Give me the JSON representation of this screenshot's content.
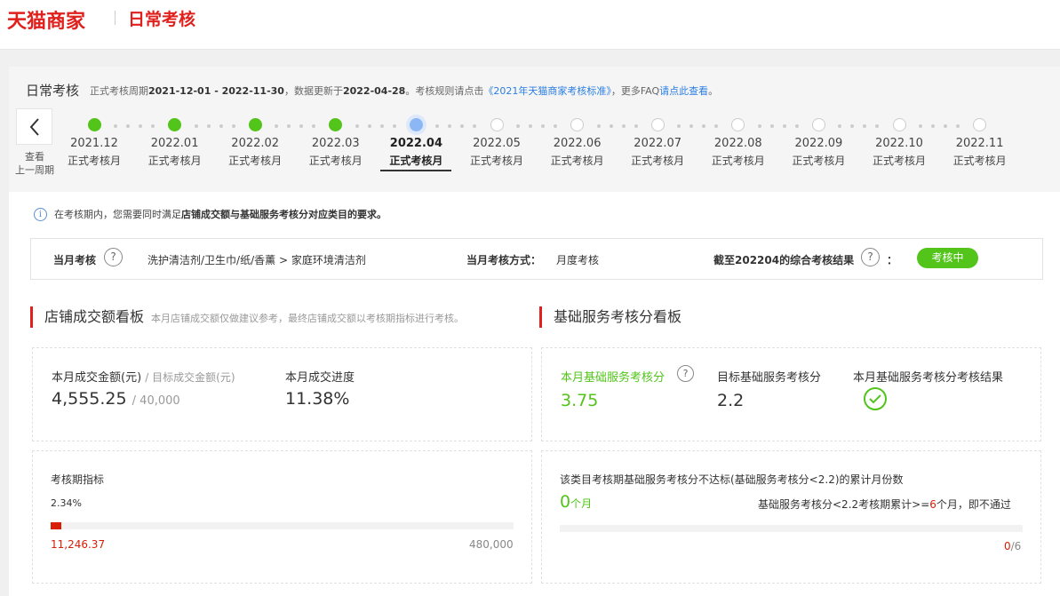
{
  "header": {
    "brand": "天猫商家",
    "section": "日常考核"
  },
  "cycle": {
    "title": "日常考核",
    "desc_prefix": "正式考核周期",
    "period": "2021-12-01 - 2022-11-30",
    "desc_mid": "，数据更新于",
    "updated": "2022-04-28",
    "desc_rule": "。考核规则请点击",
    "rule_link": "《2021年天猫商家考核标准》",
    "desc_faq": "，更多FAQ",
    "faq_link": "请点此查看",
    "desc_end": "。",
    "prev_label_1": "查看",
    "prev_label_2": "上一周期"
  },
  "timeline": [
    {
      "date": "2021.12",
      "label": "正式考核月",
      "state": "done"
    },
    {
      "date": "2022.01",
      "label": "正式考核月",
      "state": "done"
    },
    {
      "date": "2022.02",
      "label": "正式考核月",
      "state": "done"
    },
    {
      "date": "2022.03",
      "label": "正式考核月",
      "state": "done"
    },
    {
      "date": "2022.04",
      "label": "正式考核月",
      "state": "current"
    },
    {
      "date": "2022.05",
      "label": "正式考核月",
      "state": "future"
    },
    {
      "date": "2022.06",
      "label": "正式考核月",
      "state": "future"
    },
    {
      "date": "2022.07",
      "label": "正式考核月",
      "state": "future"
    },
    {
      "date": "2022.08",
      "label": "正式考核月",
      "state": "future"
    },
    {
      "date": "2022.09",
      "label": "正式考核月",
      "state": "future"
    },
    {
      "date": "2022.10",
      "label": "正式考核月",
      "state": "future"
    },
    {
      "date": "2022.11",
      "label": "正式考核月",
      "state": "future"
    }
  ],
  "notice": {
    "prefix": "在考核期内，您需要同时满足",
    "bold": "店铺成交额与基础服务考核分对应类目的要求。"
  },
  "summary": {
    "month_label": "当月考核",
    "category": "洗护清洁剂/卫生巾/纸/香薰 > 家庭环境清洁剂",
    "method_label": "当月考核方式：",
    "method_value": "月度考核",
    "result_label": "截至202204的综合考核结果",
    "colon": "：",
    "result_badge": "考核中"
  },
  "sales": {
    "title": "店铺成交额看板",
    "subtitle": "本月店铺成交额仅做建议参考，最终店铺成交额以考核期指标进行考核。",
    "amount_label": "本月成交金额(元)",
    "target_label": "/ 目标成交金额(元)",
    "amount": "4,555.25",
    "target": "/ 40,000",
    "progress_label": "本月成交进度",
    "progress": "11.38%",
    "period_label": "考核期指标",
    "period_pct": "2.34%",
    "period_fill": 0.0234,
    "period_current": "11,246.37",
    "period_target": "480,000"
  },
  "service": {
    "title": "基础服务考核分看板",
    "score_label": "本月基础服务考核分",
    "score": "3.75",
    "target_label": "目标基础服务考核分",
    "target": "2.2",
    "result_label": "本月基础服务考核分考核结果",
    "fail_title": "该类目考核期基础服务考核分不达标(基础服务考核分<2.2)的累计月份数",
    "fail_count": "0",
    "fail_unit": "个月",
    "rule_prefix": "基础服务考核分<2.2考核期累计>=",
    "rule_num": "6",
    "rule_suffix": "个月，即不通过",
    "fail_fill": 0,
    "ratio_num": "0",
    "ratio_den": "/6"
  },
  "colors": {
    "brand": "#e0201c",
    "success": "#52c41a",
    "accent_blue": "#2a7ee3",
    "danger": "#d81e06"
  },
  "icons": [
    "chevron-left-icon",
    "info-icon",
    "question-icon",
    "check-circle-icon"
  ]
}
